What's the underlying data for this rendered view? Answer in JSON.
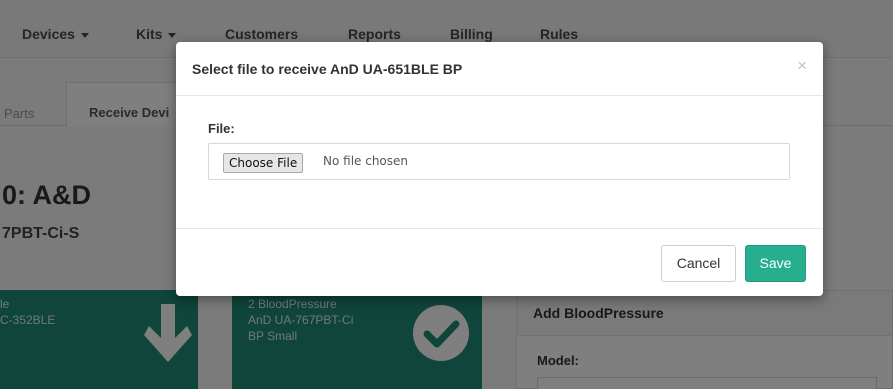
{
  "navbar": {
    "items": [
      {
        "label": "Devices",
        "dropdown": true
      },
      {
        "label": "Kits",
        "dropdown": true
      },
      {
        "label": "Customers"
      },
      {
        "label": "Reports"
      },
      {
        "label": "Billing"
      },
      {
        "label": "Rules"
      }
    ]
  },
  "tabs": [
    "Parts",
    "Receive Devi"
  ],
  "page": {
    "title": "0: A&D",
    "subtitle": "7PBT-Ci-S"
  },
  "cards": [
    {
      "lines": [
        "le",
        "C-352BLE"
      ],
      "icon": "arrow-down-icon"
    },
    {
      "lines": [
        "2 BloodPressure",
        "AnD UA-767PBT-Ci",
        "BP Small"
      ],
      "icon": "check-circle-icon"
    }
  ],
  "panel": {
    "title": "Add BloodPressure",
    "model_label": "Model:"
  },
  "modal": {
    "title": "Select file to receive AnD UA-651BLE BP",
    "close": "×",
    "file_label": "File:",
    "choose_button": "Choose File",
    "file_status": "No file chosen",
    "cancel_label": "Cancel",
    "save_label": "Save"
  },
  "colors": {
    "accent": "#26ae8f",
    "card": "#1f8a74"
  }
}
